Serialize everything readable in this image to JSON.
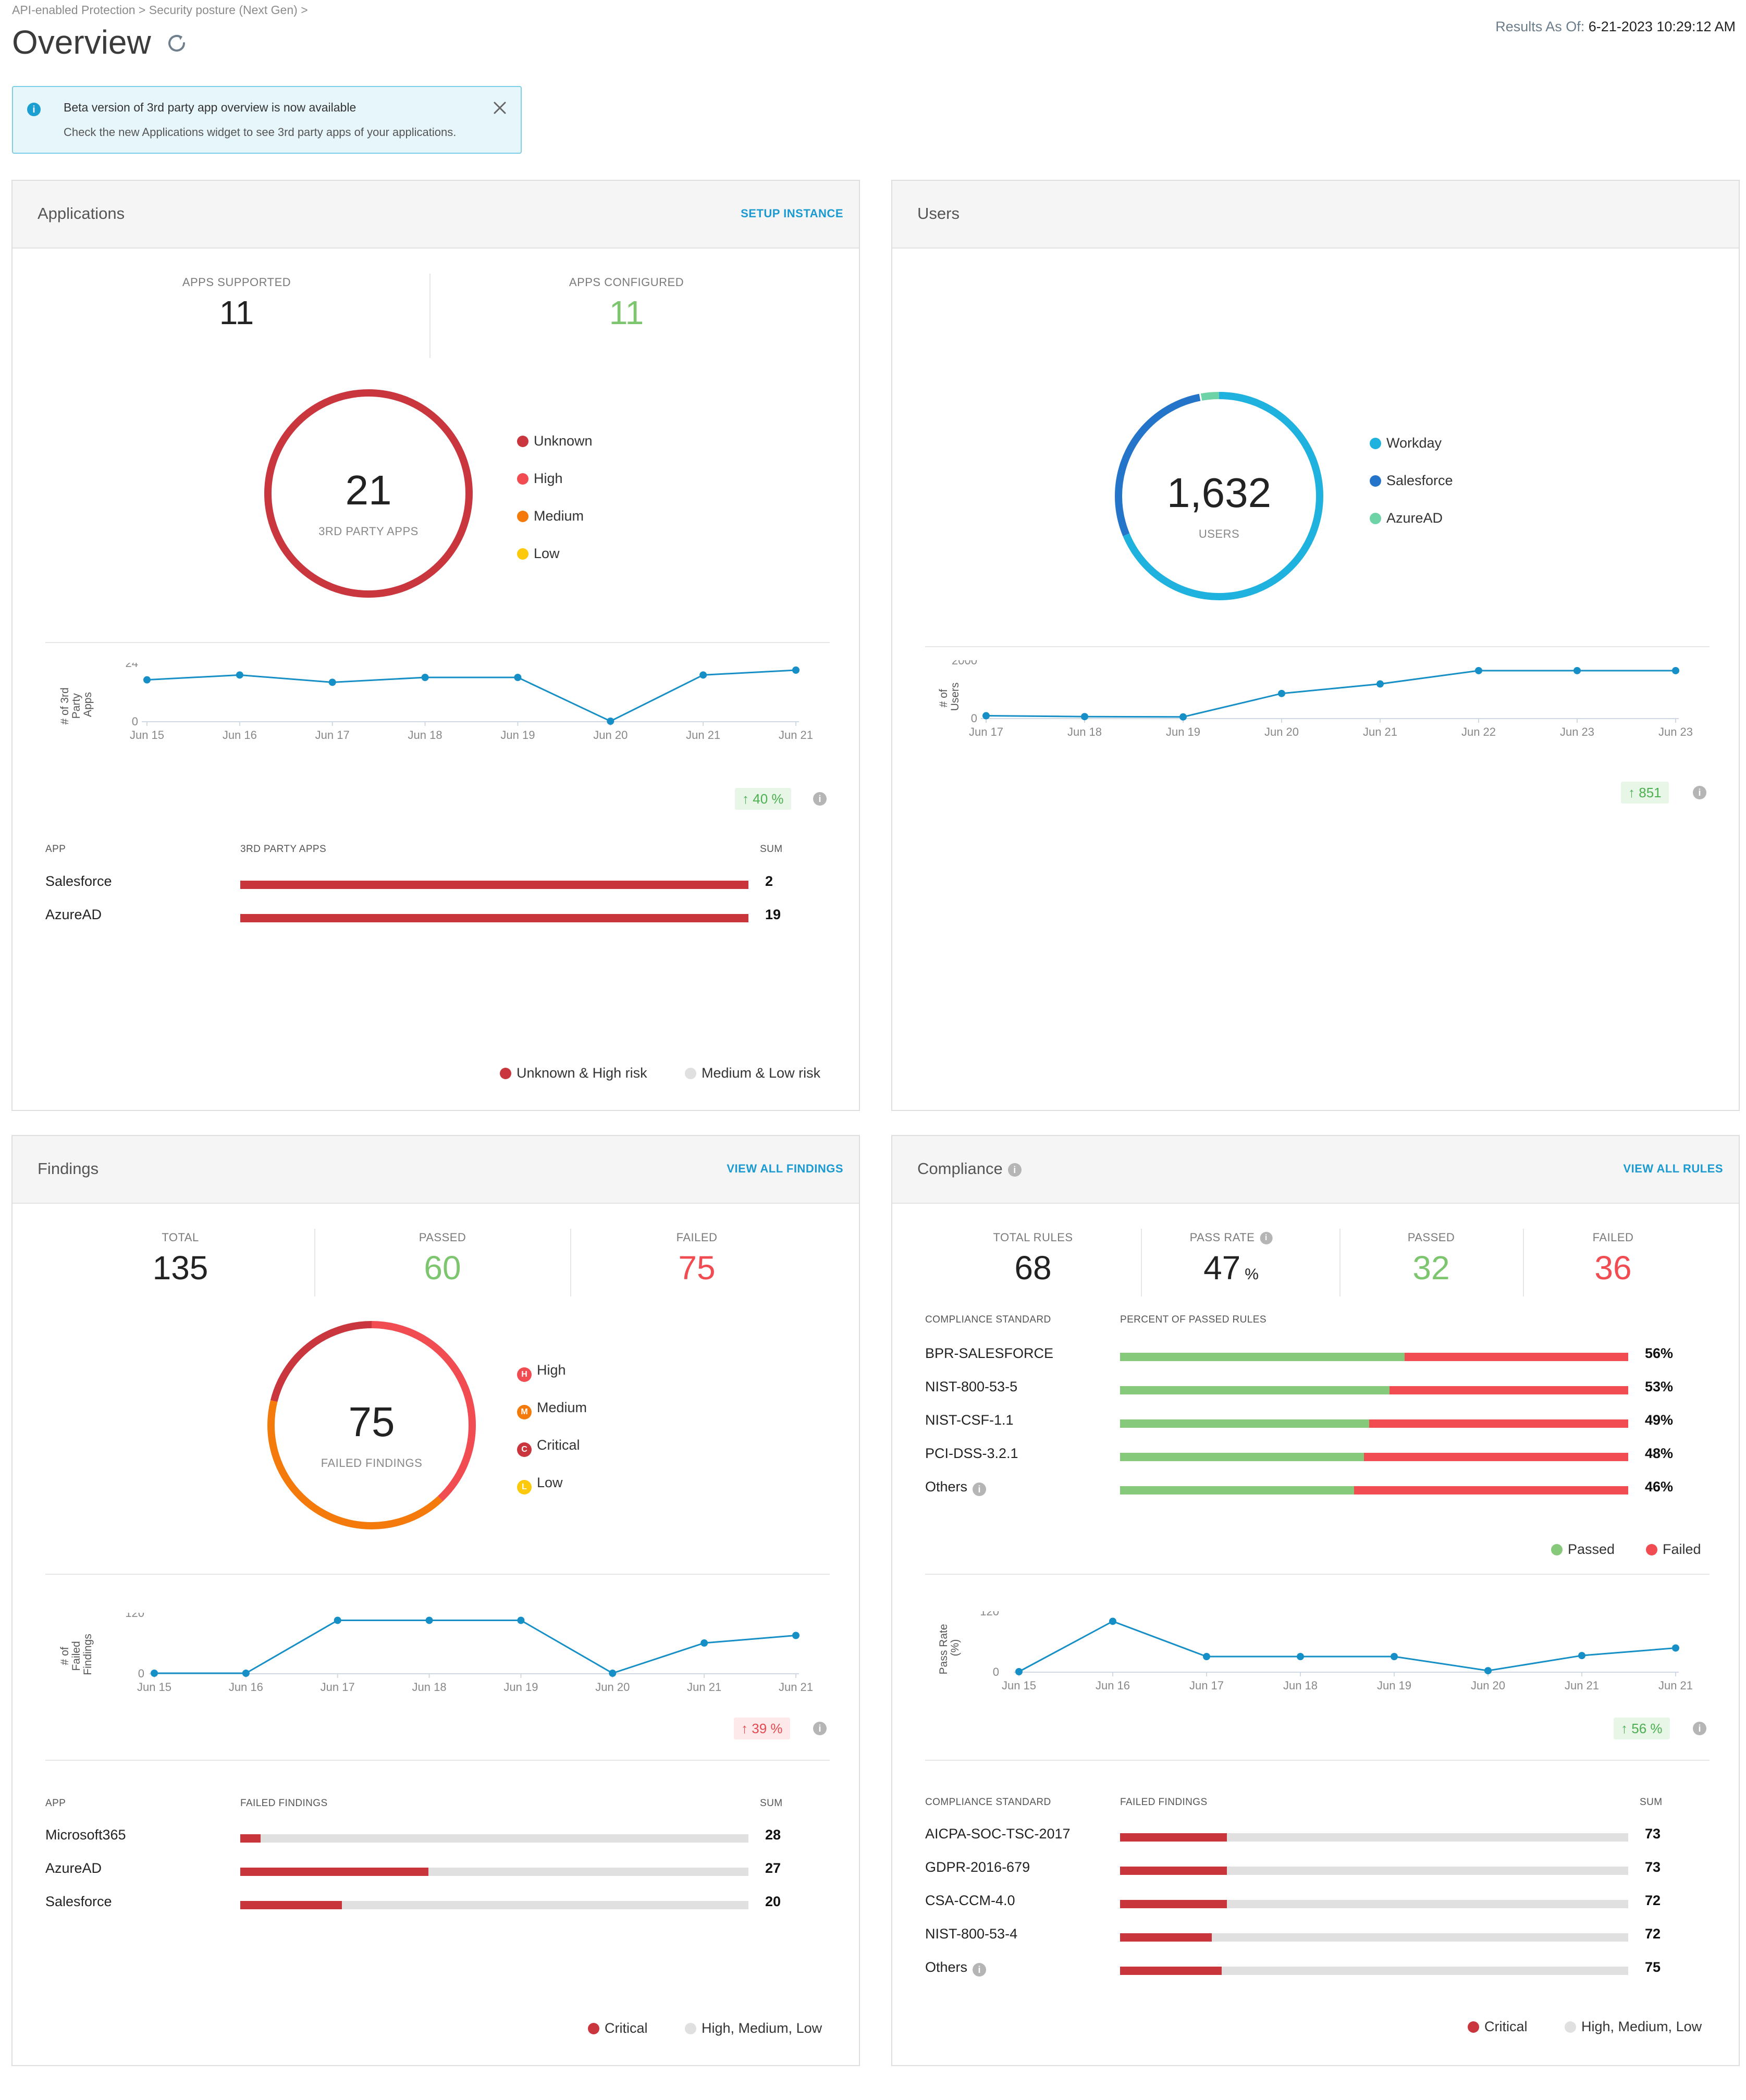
{
  "header": {
    "breadcrumb": "API-enabled Protection > Security posture (Next Gen) >",
    "title": "Overview",
    "results_label": "Results As Of:",
    "results_value": "6-21-2023 10:29:12 AM"
  },
  "banner": {
    "title": "Beta version of 3rd party app overview is now available",
    "text": "Check the new Applications widget to see 3rd party apps of your applications."
  },
  "colors": {
    "accent": "#1a9ad1",
    "red": "#c8363c",
    "green": "#7dc66f",
    "fail_red": "#f04c51"
  },
  "applications": {
    "title": "Applications",
    "link": "SETUP INSTANCE",
    "stats": [
      {
        "label": "APPS SUPPORTED",
        "value": "11"
      },
      {
        "label": "APPS CONFIGURED",
        "value": "11"
      }
    ],
    "donut": {
      "value": "21",
      "label": "3RD PARTY APPS"
    },
    "legend": [
      "Unknown",
      "High",
      "Medium",
      "Low"
    ],
    "chart": {
      "ylabel_l1": "# of 3rd",
      "ylabel_l2": "Party",
      "ylabel_l3": "Apps",
      "ytick_max": "24",
      "ytick_min": "0",
      "x": [
        "Jun 15",
        "Jun 16",
        "Jun 17",
        "Jun 18",
        "Jun 19",
        "Jun 20",
        "Jun 21",
        "Jun 21"
      ],
      "y": [
        17,
        19,
        16,
        18,
        18,
        0,
        19,
        21
      ],
      "ylim": [
        0,
        24
      ]
    },
    "delta": "40 %",
    "table": {
      "col_app": "APP",
      "col_bar": "3RD PARTY APPS",
      "col_sum": "SUM",
      "rows": [
        {
          "app": "Salesforce",
          "sum": "2",
          "fraction": 1.0
        },
        {
          "app": "AzureAD",
          "sum": "19",
          "fraction": 1.0
        }
      ]
    },
    "bottom_legend": [
      "Unknown & High risk",
      "Medium & Low risk"
    ]
  },
  "users": {
    "title": "Users",
    "donut": {
      "value": "1,632",
      "label": "USERS"
    },
    "legend": [
      "Workday",
      "Salesforce",
      "AzureAD"
    ],
    "chart": {
      "ylabel_l1": "# of",
      "ylabel_l2": "Users",
      "ytick_max": "2000",
      "ytick_min": "0",
      "x": [
        "Jun 17",
        "Jun 18",
        "Jun 19",
        "Jun 20",
        "Jun 21",
        "Jun 22",
        "Jun 23",
        "Jun 23"
      ],
      "y": [
        80,
        50,
        40,
        850,
        1180,
        1640,
        1640,
        1640
      ],
      "ylim": [
        0,
        2000
      ]
    },
    "delta": "851"
  },
  "findings": {
    "title": "Findings",
    "link": "VIEW ALL FINDINGS",
    "stats": [
      {
        "label": "TOTAL",
        "value": "135"
      },
      {
        "label": "PASSED",
        "value": "60"
      },
      {
        "label": "FAILED",
        "value": "75"
      }
    ],
    "donut": {
      "value": "75",
      "label": "FAILED FINDINGS"
    },
    "legend": [
      {
        "letter": "H",
        "label": "High"
      },
      {
        "letter": "M",
        "label": "Medium"
      },
      {
        "letter": "C",
        "label": "Critical"
      },
      {
        "letter": "L",
        "label": "Low"
      }
    ],
    "chart": {
      "ylabel_l1": "# of",
      "ylabel_l2": "Failed",
      "ylabel_l3": "Findings",
      "ytick_max": "120",
      "ytick_min": "0",
      "x": [
        "Jun 15",
        "Jun 16",
        "Jun 17",
        "Jun 18",
        "Jun 19",
        "Jun 20",
        "Jun 21",
        "Jun 21"
      ],
      "y": [
        0,
        0,
        105,
        105,
        105,
        0,
        60,
        75
      ],
      "ylim": [
        0,
        120
      ]
    },
    "delta": "39 %",
    "table": {
      "col_app": "APP",
      "col_bar": "FAILED FINDINGS",
      "col_sum": "SUM",
      "rows": [
        {
          "app": "Microsoft365",
          "sum": "28",
          "fraction": 0.04
        },
        {
          "app": "AzureAD",
          "sum": "27",
          "fraction": 0.37
        },
        {
          "app": "Salesforce",
          "sum": "20",
          "fraction": 0.2
        }
      ]
    },
    "bottom_legend": [
      "Critical",
      "High, Medium, Low"
    ]
  },
  "compliance": {
    "title": "Compliance",
    "link": "VIEW ALL RULES",
    "stats": [
      {
        "label": "TOTAL RULES",
        "value": "68"
      },
      {
        "label": "PASS RATE",
        "value": "47",
        "unit": "%"
      },
      {
        "label": "PASSED",
        "value": "32"
      },
      {
        "label": "FAILED",
        "value": "36"
      }
    ],
    "standards_head": {
      "col_std": "COMPLIANCE STANDARD",
      "col_pct": "PERCENT OF PASSED RULES"
    },
    "standards": [
      {
        "name": "BPR-SALESFORCE",
        "pct": "56%",
        "fraction": 0.56
      },
      {
        "name": "NIST-800-53-5",
        "pct": "53%",
        "fraction": 0.53
      },
      {
        "name": "NIST-CSF-1.1",
        "pct": "49%",
        "fraction": 0.49
      },
      {
        "name": "PCI-DSS-3.2.1",
        "pct": "48%",
        "fraction": 0.48
      },
      {
        "name": "Others",
        "pct": "46%",
        "fraction": 0.46
      }
    ],
    "pass_legend": [
      "Passed",
      "Failed"
    ],
    "chart": {
      "ylabel_l1": "Pass Rate",
      "ylabel_l2": "(%)",
      "ytick_max": "120",
      "ytick_min": "0",
      "x": [
        "Jun 15",
        "Jun 16",
        "Jun 17",
        "Jun 18",
        "Jun 19",
        "Jun 20",
        "Jun 21",
        "Jun 21"
      ],
      "y": [
        0,
        100,
        30,
        30,
        30,
        2,
        32,
        47
      ],
      "ylim": [
        0,
        120
      ]
    },
    "delta": "56 %",
    "table": {
      "col_std": "COMPLIANCE STANDARD",
      "col_bar": "FAILED FINDINGS",
      "col_sum": "SUM",
      "rows": [
        {
          "name": "AICPA-SOC-TSC-2017",
          "sum": "73",
          "fraction": 0.21
        },
        {
          "name": "GDPR-2016-679",
          "sum": "73",
          "fraction": 0.21
        },
        {
          "name": "CSA-CCM-4.0",
          "sum": "72",
          "fraction": 0.21
        },
        {
          "name": "NIST-800-53-4",
          "sum": "72",
          "fraction": 0.18
        },
        {
          "name": "Others",
          "sum": "75",
          "fraction": 0.2
        }
      ]
    },
    "bottom_legend": [
      "Critical",
      "High, Medium, Low"
    ]
  }
}
